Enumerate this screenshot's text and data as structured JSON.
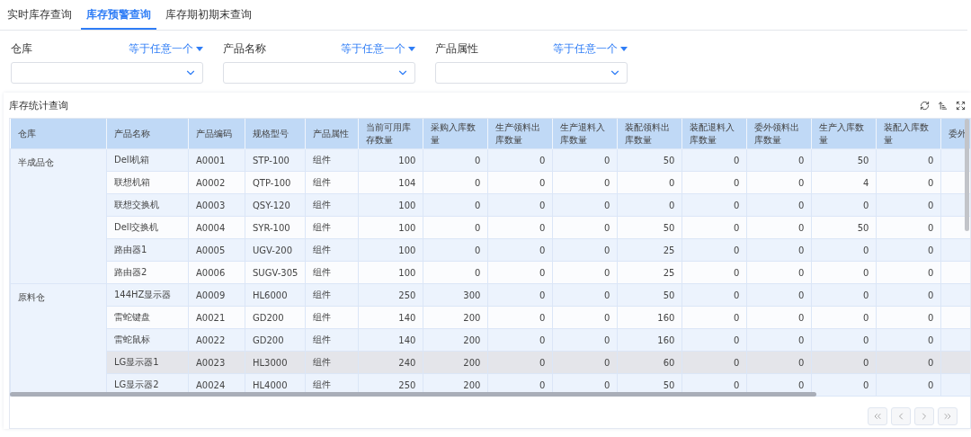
{
  "tabs": [
    {
      "label": "实时库存查询",
      "selected": false
    },
    {
      "label": "库存预警查询",
      "selected": true
    },
    {
      "label": "库存期初期末查询",
      "selected": false
    }
  ],
  "filters": [
    {
      "label": "仓库",
      "operator": "等于任意一个"
    },
    {
      "label": "产品名称",
      "operator": "等于任意一个"
    },
    {
      "label": "产品属性",
      "operator": "等于任意一个"
    }
  ],
  "panel": {
    "title": "库存统计查询"
  },
  "table": {
    "columns": [
      "仓库",
      "产品名称",
      "产品编码",
      "规格型号",
      "产品属性",
      "当前可用库存数量",
      "采购入库数量",
      "生产领料出库数量",
      "生产退料入库数量",
      "装配领料出库数量",
      "装配退料入库数量",
      "委外领料出库数量",
      "生产入库数量",
      "装配入库数量",
      "委外"
    ],
    "groups": [
      {
        "warehouse": "半成品仓",
        "rows": [
          {
            "hovered": false,
            "cells": [
              "Dell机箱",
              "A0001",
              "STP-100",
              "组件",
              "100",
              "0",
              "0",
              "0",
              "50",
              "0",
              "0",
              "50",
              "0"
            ]
          },
          {
            "hovered": false,
            "cells": [
              "联想机箱",
              "A0002",
              "QTP-100",
              "组件",
              "104",
              "0",
              "0",
              "0",
              "0",
              "0",
              "0",
              "4",
              "0"
            ]
          },
          {
            "hovered": false,
            "cells": [
              "联想交换机",
              "A0003",
              "QSY-120",
              "组件",
              "100",
              "0",
              "0",
              "0",
              "0",
              "0",
              "0",
              "0",
              "0"
            ]
          },
          {
            "hovered": false,
            "cells": [
              "Dell交换机",
              "A0004",
              "SYR-100",
              "组件",
              "100",
              "0",
              "0",
              "0",
              "50",
              "0",
              "0",
              "50",
              "0"
            ]
          },
          {
            "hovered": false,
            "cells": [
              "路由器1",
              "A0005",
              "UGV-200",
              "组件",
              "100",
              "0",
              "0",
              "0",
              "25",
              "0",
              "0",
              "0",
              "0"
            ]
          },
          {
            "hovered": false,
            "cells": [
              "路由器2",
              "A0006",
              "SUGV-305",
              "组件",
              "100",
              "0",
              "0",
              "0",
              "25",
              "0",
              "0",
              "0",
              "0"
            ]
          }
        ]
      },
      {
        "warehouse": "原料仓",
        "rows": [
          {
            "hovered": false,
            "cells": [
              "144HZ显示器",
              "A0009",
              "HL6000",
              "组件",
              "250",
              "300",
              "0",
              "0",
              "50",
              "0",
              "0",
              "0",
              "0"
            ]
          },
          {
            "hovered": false,
            "cells": [
              "雷蛇键盘",
              "A0021",
              "GD200",
              "组件",
              "140",
              "200",
              "0",
              "0",
              "160",
              "0",
              "0",
              "0",
              "0"
            ]
          },
          {
            "hovered": false,
            "cells": [
              "雷蛇鼠标",
              "A0022",
              "GD200",
              "组件",
              "140",
              "200",
              "0",
              "0",
              "160",
              "0",
              "0",
              "0",
              "0"
            ]
          },
          {
            "hovered": true,
            "cells": [
              "LG显示器1",
              "A0023",
              "HL3000",
              "组件",
              "240",
              "200",
              "0",
              "0",
              "60",
              "0",
              "0",
              "0",
              "0"
            ]
          },
          {
            "hovered": false,
            "cells": [
              "LG显示器2",
              "A0024",
              "HL4000",
              "组件",
              "250",
              "200",
              "0",
              "0",
              "50",
              "0",
              "0",
              "0",
              "0"
            ]
          }
        ]
      }
    ]
  }
}
